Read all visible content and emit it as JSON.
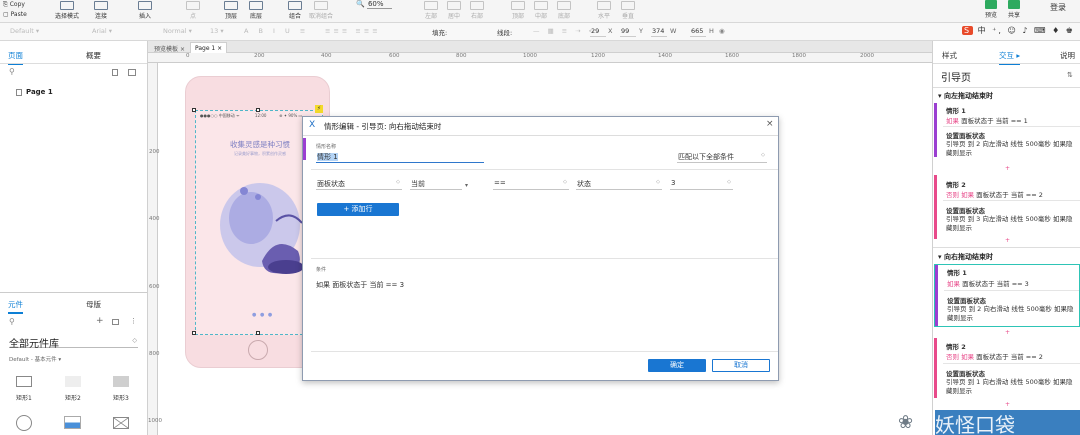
{
  "toolbar": {
    "copy": "Copy",
    "paste": "Paste",
    "select_mode": "选择模式",
    "connect": "连接",
    "insert": "插入",
    "top": "顶层",
    "bottom": "底层",
    "group": "组合",
    "ungroup": "取消组合",
    "zoom": "60%",
    "left": "左部",
    "center": "居中",
    "right": "右部",
    "top_align": "顶部",
    "middle": "中部",
    "bottom_align": "底部",
    "horizontal": "水平",
    "vertical": "垂直",
    "preview": "预览",
    "share": "共享",
    "login": "登录"
  },
  "format_bar": {
    "style": "Default",
    "font": "Arial",
    "weight": "Normal",
    "size": "13",
    "fill": "填充:",
    "border": "线段:",
    "x": "29",
    "x_label": "X",
    "y": "99",
    "y_label": "Y",
    "w": "374",
    "w_label": "W",
    "h": "665",
    "h_label": "H"
  },
  "pages_panel": {
    "tab_pages": "页面",
    "tab_outline": "概要",
    "page_item": "Page 1"
  },
  "library_panel": {
    "tab_widgets": "元件",
    "tab_masters": "母版",
    "library_name": "全部元件库",
    "subtitle": "Default - 基本元件 ▾",
    "items": [
      "矩形1",
      "矩形2",
      "矩形3"
    ]
  },
  "canvas": {
    "tab1": "预览模板",
    "tab2": "Page 1",
    "ruler_h": [
      "0",
      "200",
      "400",
      "600",
      "800",
      "1000",
      "1200",
      "1400",
      "1600",
      "1800",
      "2000"
    ],
    "ruler_v": [
      "200",
      "400",
      "600",
      "800",
      "1000"
    ],
    "phone_title": "收集灵感是种习惯",
    "phone_sub": "记录美好事物，积累创作灵感"
  },
  "dialog": {
    "title": "情形编辑  -  引导页: 向右拖动结束时",
    "case_name_label": "情形名称",
    "case_name_value": "情形 1",
    "match_mode": "匹配以下全部条件",
    "cond_target": "面板状态",
    "cond_object": "当前",
    "cond_operator": "==",
    "cond_value_type": "状态",
    "cond_value": "3",
    "add_row": "+ 添加行",
    "conditions_label": "条件",
    "conditions_text": "如果  面板状态于 当前 == 3",
    "ok": "确定",
    "cancel": "取消"
  },
  "right_panel": {
    "tab_style": "样式",
    "tab_interactions": "交互",
    "tab_notes": "说明",
    "widget_name": "引导页",
    "event1": "向左拖动结束时",
    "event2": "向右拖动结束时",
    "set_panel_state": "设置面板状态",
    "cases": [
      {
        "name": "情形 1",
        "prefix": "如果",
        "cond": "面板状态于 当前 == 1",
        "action": "引导页 到 2 向左滑动 线性 500毫秒 如果隐藏则显示"
      },
      {
        "name": "情形 2",
        "prefix": "否则 如果",
        "cond": "面板状态于 当前 == 2",
        "action": "引导页 到 3 向左滑动 线性 500毫秒 如果隐藏则显示"
      },
      {
        "name": "情形 1",
        "prefix": "如果",
        "cond": "面板状态于 当前 == 3",
        "action": "引导页 到 2 向右滑动 线性 500毫秒 如果隐藏则显示"
      },
      {
        "name": "情形 2",
        "prefix": "否则 如果",
        "cond": "面板状态于 当前 == 2",
        "action": "引导页 到 1 向右滑动 线性 500毫秒 如果隐藏则显示"
      }
    ]
  },
  "watermark": "妖怪口袋",
  "colors": {
    "accent": "#0d7fd5",
    "button": "#1976d2",
    "case_bar": "#9b3fd1",
    "pink": "#e84a8a",
    "selected_case": "#2ec4b6"
  }
}
